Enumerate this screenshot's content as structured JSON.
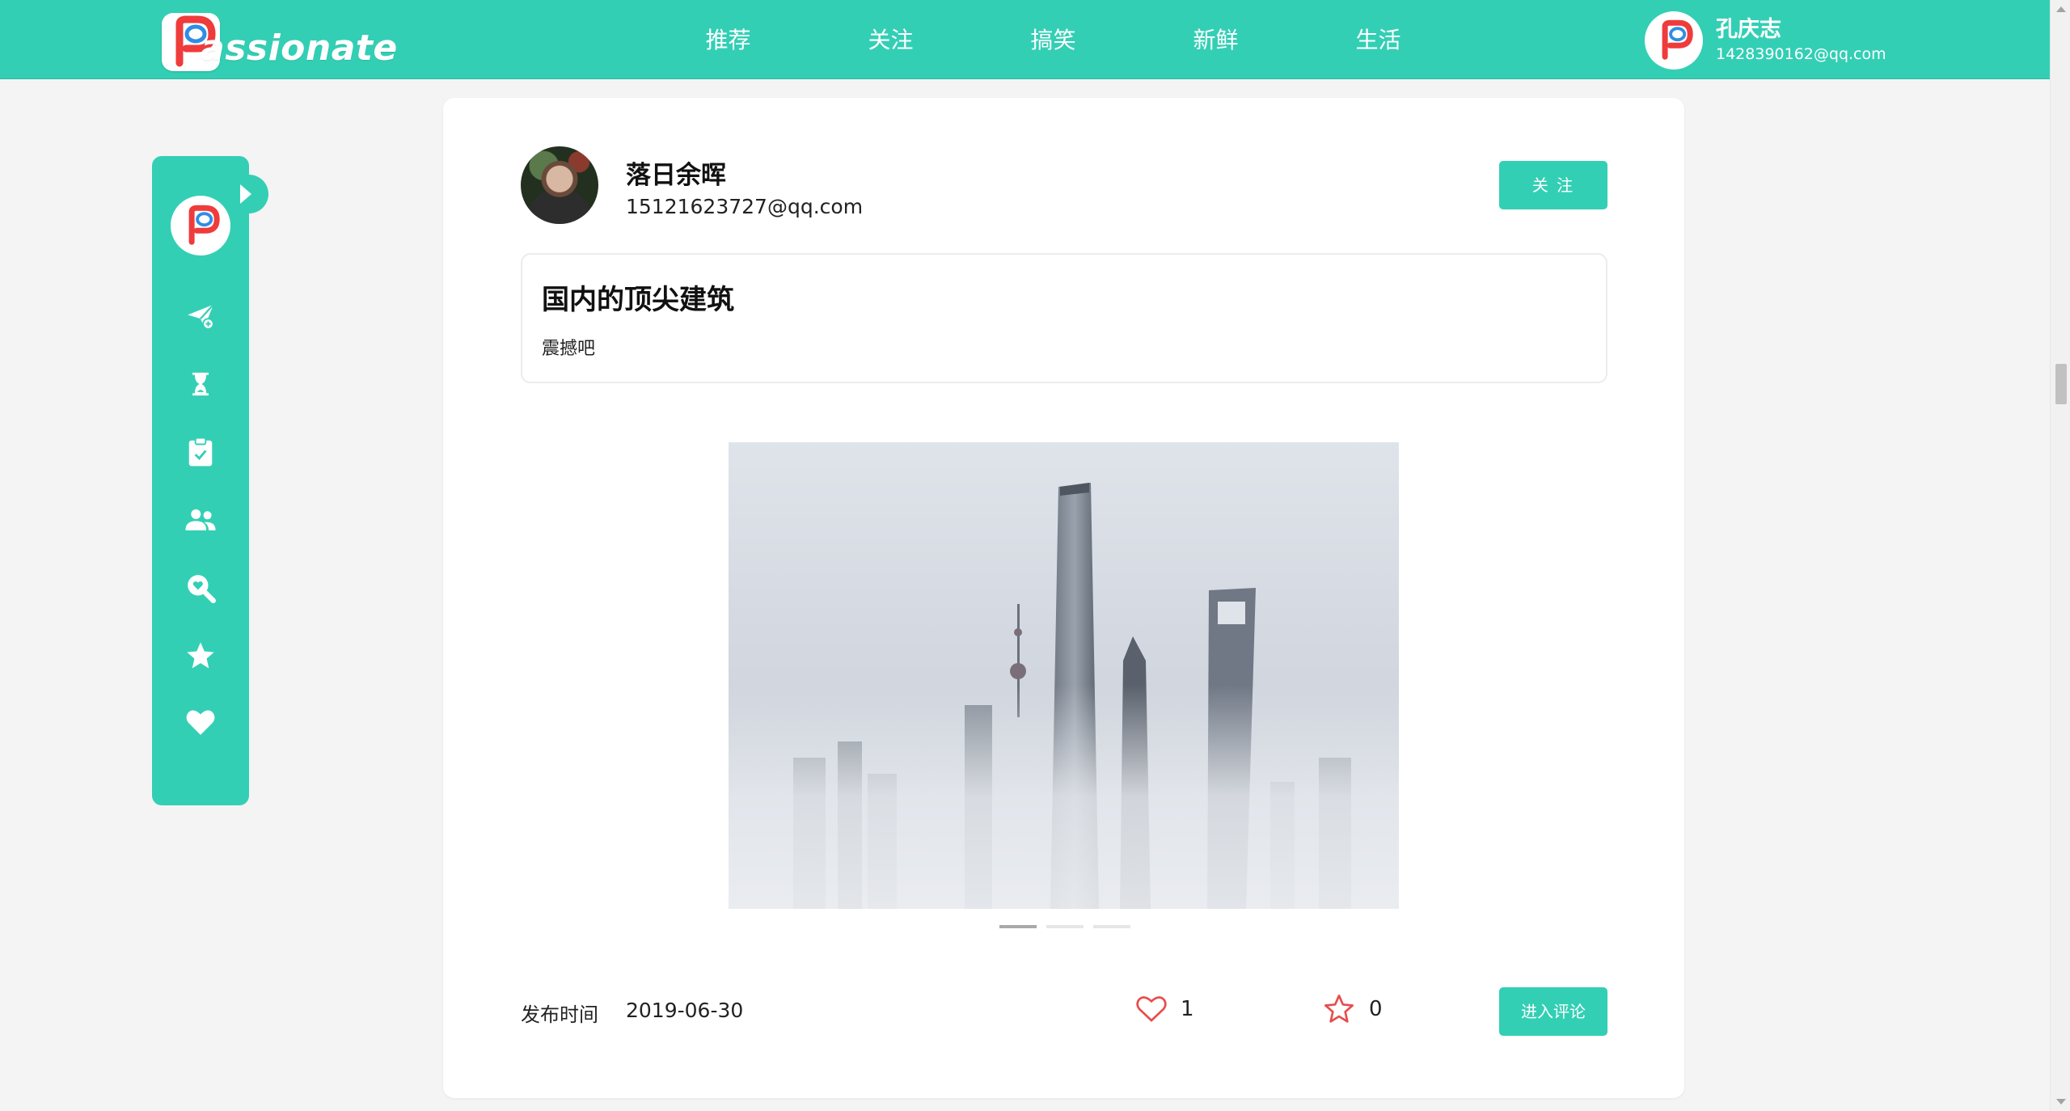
{
  "brand": {
    "logo_letter": "P",
    "logo_text": "assionate",
    "primary_color": "#33cfb5",
    "accent_color": "#ef3b3b"
  },
  "nav": {
    "items": [
      {
        "label": "推荐"
      },
      {
        "label": "关注"
      },
      {
        "label": "搞笑"
      },
      {
        "label": "新鲜"
      },
      {
        "label": "生活"
      }
    ]
  },
  "user": {
    "name": "孔庆志",
    "email": "1428390162@qq.com"
  },
  "sidebar": {
    "icons": [
      {
        "name": "send-icon"
      },
      {
        "name": "hourglass-icon"
      },
      {
        "name": "clipboard-check-icon"
      },
      {
        "name": "users-icon"
      },
      {
        "name": "search-heart-icon"
      },
      {
        "name": "star-icon"
      },
      {
        "name": "heart-icon"
      }
    ]
  },
  "post": {
    "author_name": "落日余晖",
    "author_email": "15121623727@qq.com",
    "follow_label": "关 注",
    "title": "国内的顶尖建筑",
    "body": "震撼吧",
    "publish_label": "发布时间",
    "publish_date": "2019-06-30",
    "likes": "1",
    "favorites": "0",
    "comment_label": "进入评论",
    "carousel": {
      "count": 3,
      "active_index": 0
    }
  }
}
